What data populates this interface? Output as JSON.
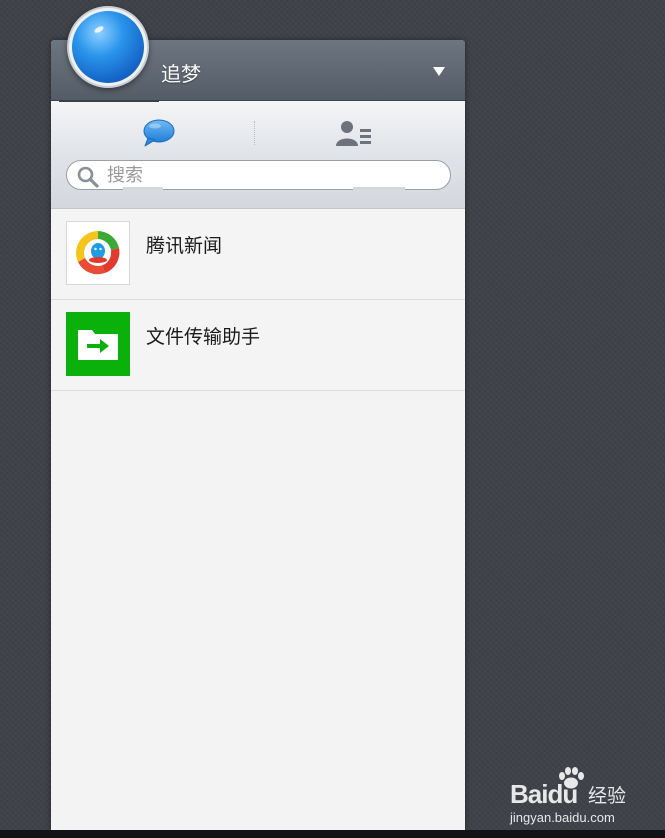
{
  "profile": {
    "name": "追梦"
  },
  "tabs": [
    {
      "id": "chats",
      "icon": "chat-bubble-icon",
      "active": true
    },
    {
      "id": "contacts",
      "icon": "contacts-icon",
      "active": false
    }
  ],
  "search": {
    "placeholder": "搜索",
    "value": ""
  },
  "conversations": [
    {
      "name": "腾讯新闻",
      "icon": "tencent-news-icon"
    },
    {
      "name": "文件传输助手",
      "icon": "file-transfer-icon"
    }
  ],
  "watermark": {
    "brand": "Baidu",
    "label": "经验",
    "url": "jingyan.baidu.com"
  },
  "colors": {
    "background": "#3e4147",
    "titlebar": "#5f6772",
    "accent_blue": "#2a8de6",
    "file_green": "#0ab10a"
  }
}
